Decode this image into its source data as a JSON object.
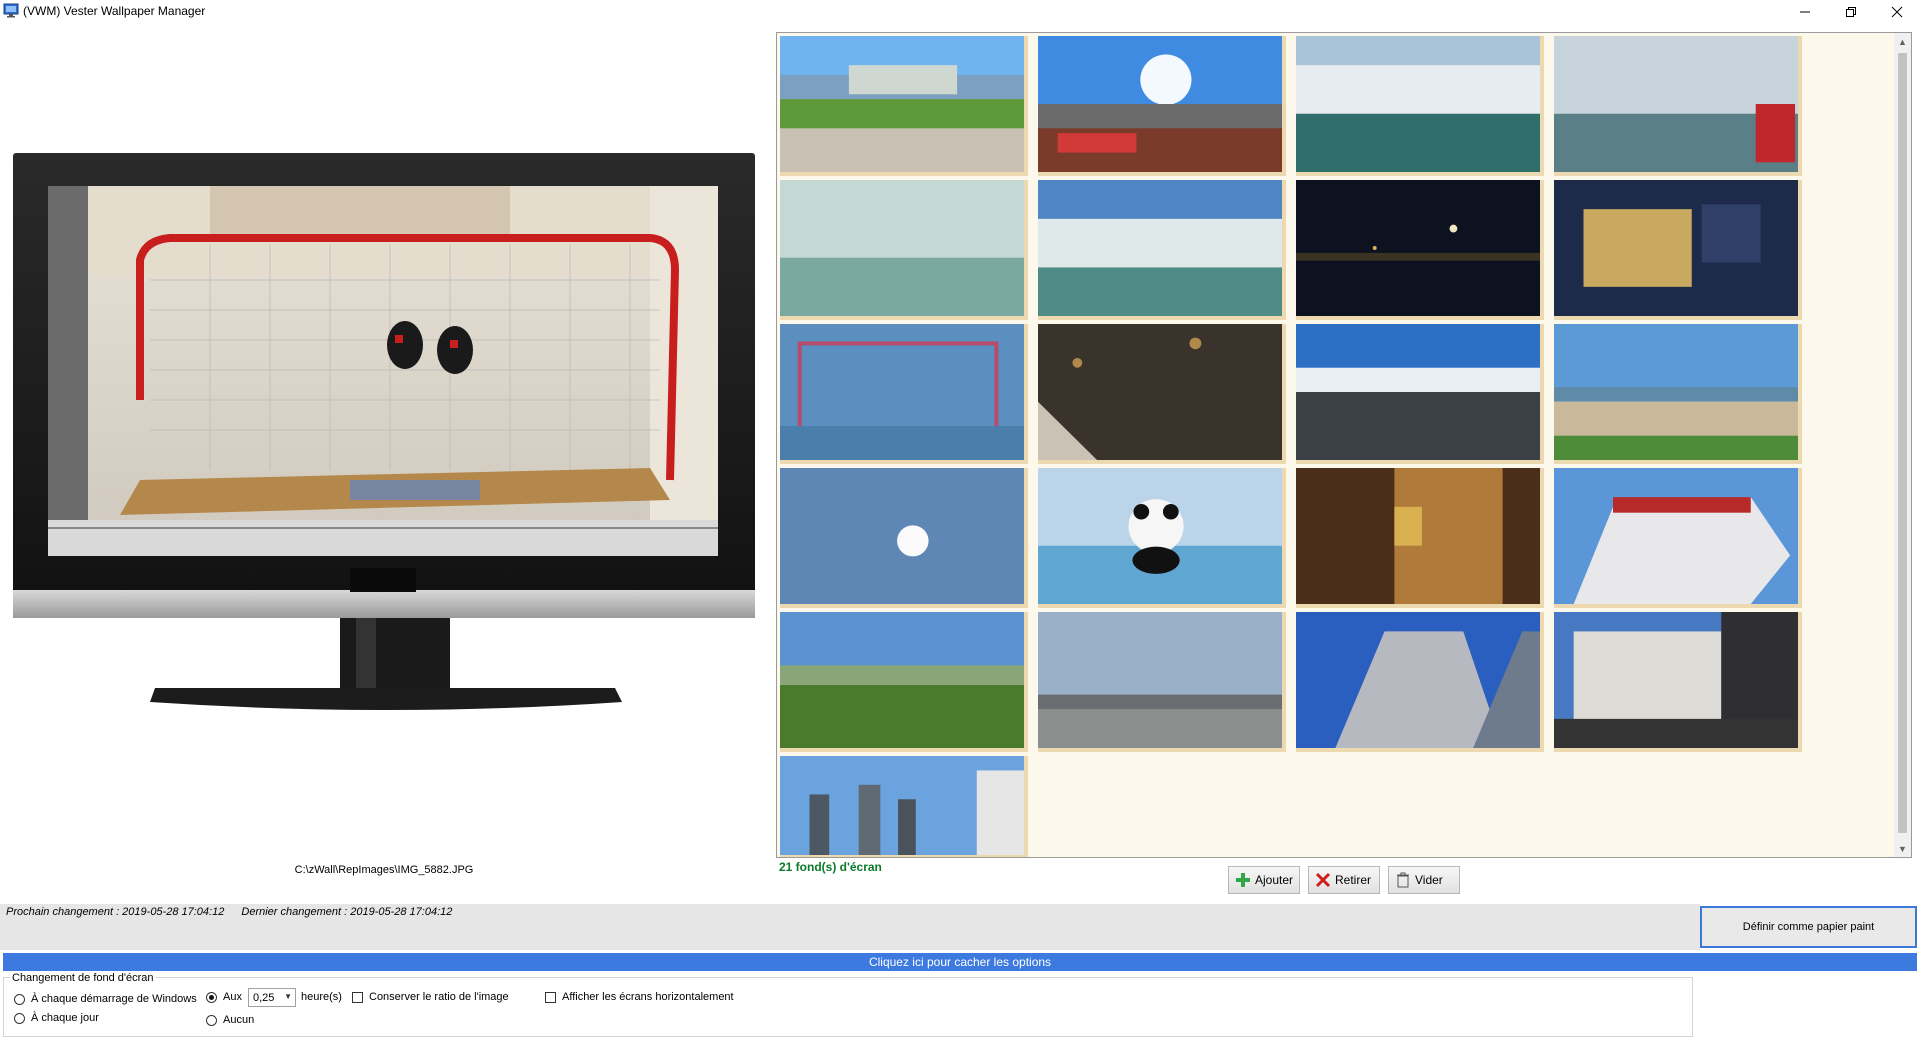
{
  "window": {
    "title": "(VWM) Vester Wallpaper Manager"
  },
  "preview": {
    "path": "C:\\zWall\\RepImages\\IMG_5882.JPG"
  },
  "gallery": {
    "count_label": "21 fond(s) d'écran"
  },
  "buttons": {
    "add_label": "Ajouter",
    "remove_label": "Retirer",
    "clear_label": "Vider",
    "set_wallpaper_label": "Définir comme papier paint"
  },
  "status": {
    "next_change": "Prochain changement : 2019-05-28 17:04:12",
    "last_change": "Dernier changement : 2019-05-28 17:04:12"
  },
  "options": {
    "toggle_label": "Cliquez ici pour cacher les options",
    "group_label": "Changement de fond d'écran",
    "at_startup": "À chaque démarrage de Windows",
    "every_day": "À chaque jour",
    "every": "Aux",
    "interval_value": "0,25",
    "hours_unit": "heure(s)",
    "none": "Aucun",
    "keep_ratio": "Conserver le ratio de l'image",
    "show_horizontal": "Afficher les écrans horizontalement"
  },
  "colors": {
    "accent": "#3c7ae0",
    "count_green": "#0c7a2a",
    "gallery_bg": "#fdf8ec",
    "thumb_border": "#ecd9b0"
  }
}
